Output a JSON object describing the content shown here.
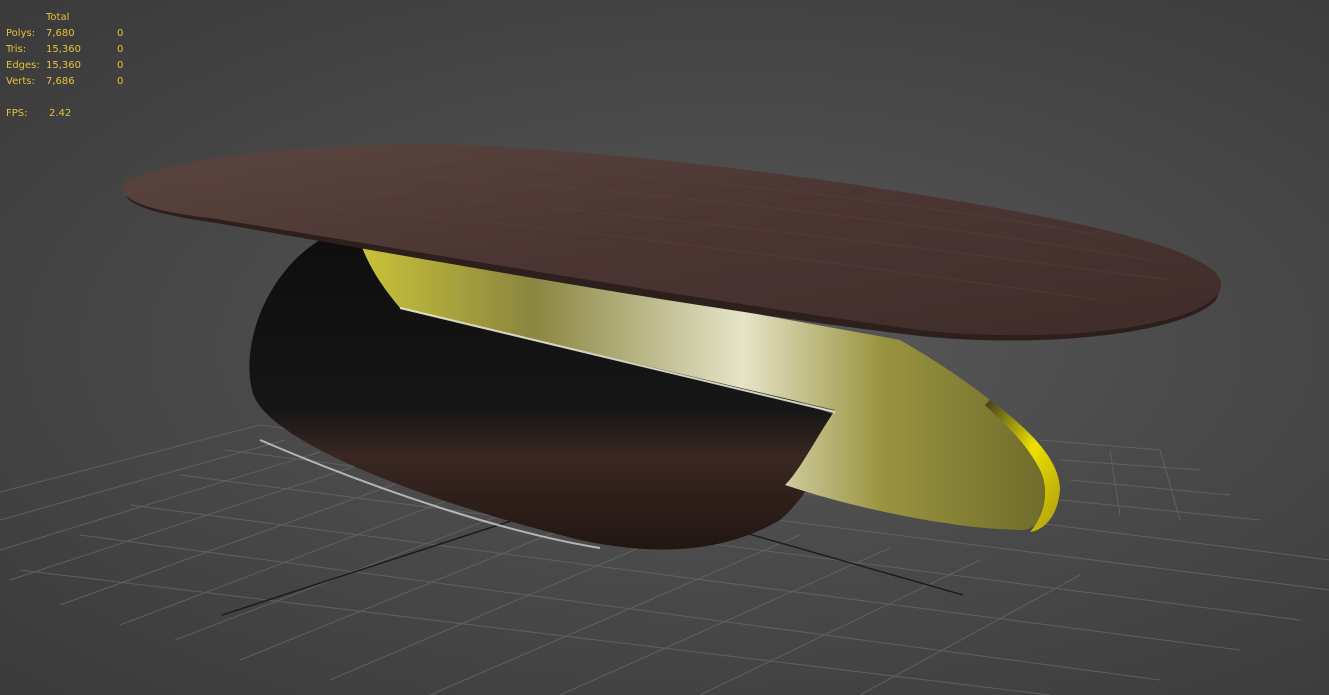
{
  "stats": {
    "header_total": "Total",
    "rows": [
      {
        "label": "Polys:",
        "total": "7,680",
        "selected": "0"
      },
      {
        "label": "Tris:",
        "total": "15,360",
        "selected": "0"
      },
      {
        "label": "Edges:",
        "total": "15,360",
        "selected": "0"
      },
      {
        "label": "Verts:",
        "total": "7,686",
        "selected": "0"
      }
    ],
    "fps_label": "FPS:",
    "fps_value": "2.42"
  },
  "colors": {
    "stats_text": "#e6c23a",
    "viewport_background": "#4a4a4a",
    "grid_line": "#6a6a6a",
    "wood": "#4a3530",
    "brass": "#c8c040"
  }
}
